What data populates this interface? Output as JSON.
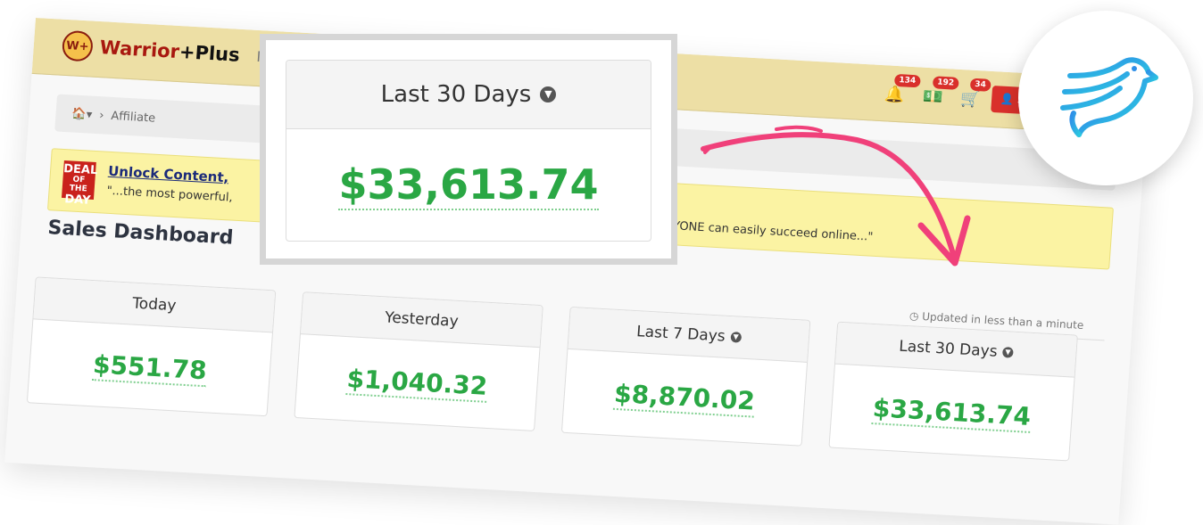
{
  "header": {
    "logo_mark": "W+",
    "logo_warrior": "Warrior",
    "logo_plus": "+Plus",
    "nav_partial": "M",
    "notifications": {
      "bell_count": "134",
      "money_count": "192",
      "cart_count": "34"
    },
    "account_button_label": "S"
  },
  "breadcrumb": {
    "home_icon": "home-icon",
    "current": "Affiliate"
  },
  "deal_of_day": {
    "badge_top": "DEAL",
    "badge_mid": "OF THE",
    "badge_bottom": "DAY",
    "title": "Unlock Content, ",
    "quote_start": "\"...the most powerful, ",
    "quote_end": "NYONE can easily succeed online...\""
  },
  "dashboard": {
    "title": "Sales Dashboard",
    "updated": "Updated in less than a minute",
    "cards": [
      {
        "label": "Today",
        "value": "$551.78"
      },
      {
        "label": "Yesterday",
        "value": "$1,040.32"
      },
      {
        "label": "Last 7 Days",
        "value": "$8,870.02"
      },
      {
        "label": "Last 30 Days",
        "value": "$33,613.74"
      }
    ]
  },
  "zoom": {
    "label": "Last 30 Days",
    "value": "$33,613.74"
  },
  "colors": {
    "accent_green": "#2aa744",
    "arrow_pink": "#f0407a",
    "header_bg": "#eddfa5",
    "bird_blue": "#2f9be8"
  }
}
